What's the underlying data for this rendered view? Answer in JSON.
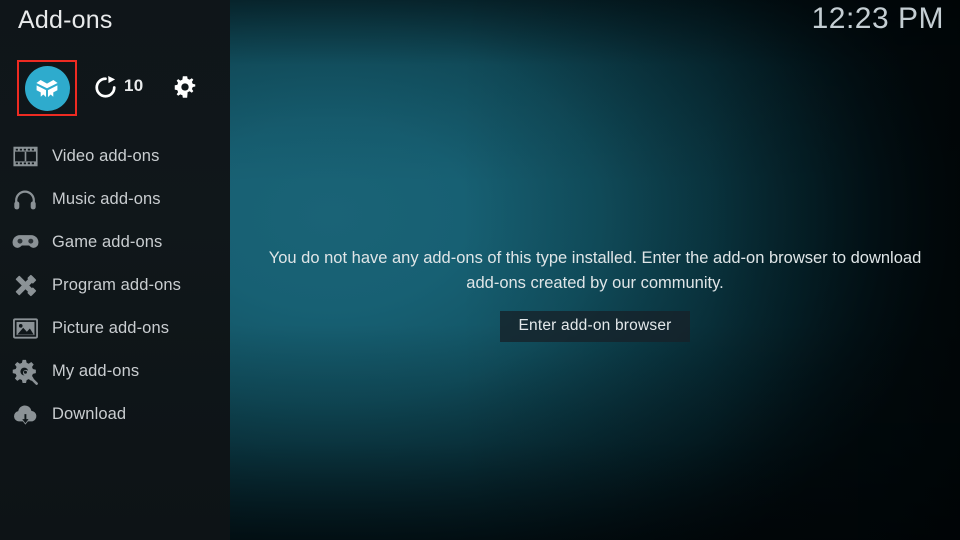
{
  "header": {
    "title": "Add-ons",
    "clock": "12:23 PM"
  },
  "toolbar": {
    "addon_button": {
      "name": "add-on-browser-shortcut",
      "icon": "open-box-icon",
      "selected": true,
      "circle_color": "#2eabcd",
      "selection_border_color": "#ee2b22"
    },
    "refresh_button": {
      "name": "check-for-updates",
      "icon": "refresh-icon",
      "count": "10"
    },
    "settings_button": {
      "name": "addon-settings",
      "icon": "gear-icon"
    }
  },
  "sidebar": {
    "items": [
      {
        "label": "Video add-ons",
        "icon": "film-strip-icon"
      },
      {
        "label": "Music add-ons",
        "icon": "headphones-icon"
      },
      {
        "label": "Game add-ons",
        "icon": "gamepad-icon"
      },
      {
        "label": "Program add-ons",
        "icon": "crossed-tools-icon"
      },
      {
        "label": "Picture add-ons",
        "icon": "picture-icon"
      },
      {
        "label": "My add-ons",
        "icon": "gear-wrench-icon"
      },
      {
        "label": "Download",
        "icon": "cloud-download-icon"
      }
    ]
  },
  "main": {
    "empty_message": "You do not have any add-ons of this type installed. Enter the add-on browser to download add-ons created by our community.",
    "browser_button_label": "Enter add-on browser"
  },
  "colors": {
    "accent_teal": "#2eabcd",
    "selection_red": "#ee2b22",
    "background_teal": "#186075",
    "sidebar_dark": "#10171a",
    "text_primary": "#e8eaeb",
    "text_secondary": "#c9cdd0"
  }
}
